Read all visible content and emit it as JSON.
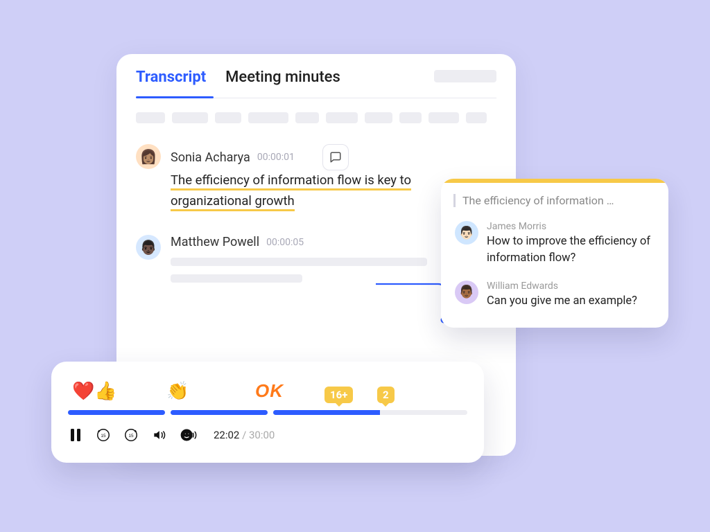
{
  "tabs": {
    "transcript": "Transcript",
    "minutes": "Meeting minutes"
  },
  "entries": [
    {
      "name": "Sonia Acharya",
      "ts": "00:00:01",
      "line1": "The efficiency of information flow is key to",
      "line2": "organizational growth"
    },
    {
      "name": "Matthew Powell",
      "ts": "00:00:05"
    }
  ],
  "comments": {
    "quote": "The efficiency of information …",
    "items": [
      {
        "name": "James Morris",
        "text": "How to improve the efficiency of information flow?"
      },
      {
        "name": "William Edwards",
        "text": "Can you give me an example?"
      }
    ]
  },
  "player": {
    "reactions": {
      "heart_thumb": "❤️👍",
      "clap": "👏",
      "ok": "OK"
    },
    "badges": {
      "b1": "16+",
      "b2": "2"
    },
    "time_current": "22:02",
    "time_total": "/ 30:00"
  }
}
